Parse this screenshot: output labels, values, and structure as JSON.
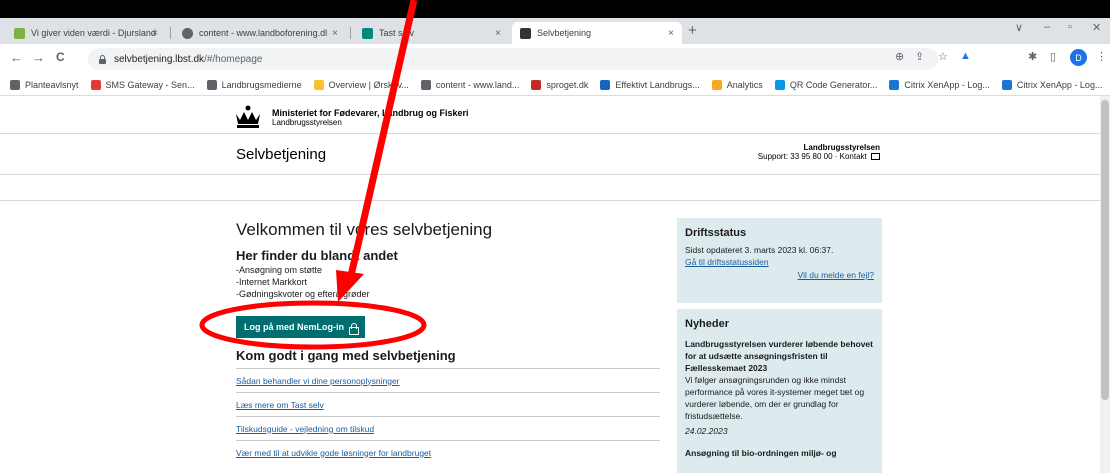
{
  "browser": {
    "tabs": [
      {
        "title": "Vi giver viden værdi - Djursland",
        "favicon_color": "#7cb342"
      },
      {
        "title": "content - www.landboforening.dl",
        "favicon_color": "#5f6368"
      },
      {
        "title": "Tast selv",
        "favicon_color": "#00897b"
      },
      {
        "title": "Selvbetjening",
        "favicon_color": "#333333"
      }
    ],
    "new_tab_label": "+",
    "tab_close": "×",
    "window_controls": {
      "chevron": "∨",
      "minimize": "–",
      "restore": "▫",
      "close": "✕"
    },
    "nav": {
      "back": "←",
      "forward": "→",
      "reload": "C"
    },
    "url_host": "selvbetjening.lbst.dk",
    "url_path": "/#/homepage",
    "profile_initial": "D",
    "toolbar_icons": {
      "zoom": "⊕",
      "share": "⇪",
      "star": "☆",
      "extensions": "✱",
      "sidebar": "▯",
      "menu": "⋮"
    },
    "bookmarks": [
      {
        "label": "Planteavlsnyt",
        "color": "#5f6368"
      },
      {
        "label": "SMS Gateway - Sen...",
        "color": "#e53935"
      },
      {
        "label": "Landbrugsmedierne",
        "color": "#5f6368"
      },
      {
        "label": "Overview | Ørskov...",
        "color": "#fbc02d"
      },
      {
        "label": "content - www.land...",
        "color": "#5f6368"
      },
      {
        "label": "sproget.dk",
        "color": "#c62828"
      },
      {
        "label": "Effektivt Landbrugs...",
        "color": "#1565c0"
      },
      {
        "label": "Analytics",
        "color": "#f9a825"
      },
      {
        "label": "QR Code Generator...",
        "color": "#039be5"
      },
      {
        "label": "Citrix XenApp - Log...",
        "color": "#1976d2"
      },
      {
        "label": "Citrix XenApp - Log...",
        "color": "#1976d2"
      }
    ]
  },
  "header": {
    "ministry_name": "Ministeriet for Fødevarer, Landbrug og Fiskeri",
    "ministry_sub": "Landbrugsstyrelsen",
    "site_title": "Selvbetjening",
    "support_org": "Landbrugsstyrelsen",
    "support_text": "Support: 33 95 80 00 · Kontakt"
  },
  "main": {
    "welcome": "Velkommen til vores selvbetjening",
    "subheading": "Her finder du blandt andet",
    "bullets": [
      "-Ansøgning om støtte",
      "-Internet Markkort",
      "-Gødningskvoter og efterafgrøder"
    ],
    "login_button": "Log på med NemLog-in",
    "guide_heading": "Kom godt i gang med selvbetjening",
    "links": [
      "Sådan behandler vi dine personoplysninger",
      "Læs mere om Tast selv",
      "Tilskudsguide - vejledning om tilskud",
      "Vær med til at udvikle gode løsninger for landbruget"
    ]
  },
  "sidebar": {
    "status_title": "Driftsstatus",
    "status_updated": "Sidst opdateret 3. marts 2023 kl. 06:37.",
    "status_link": "Gå til driftsstatussiden",
    "report_link": "Vil du melde en fejl?",
    "news_title": "Nyheder",
    "news": [
      {
        "headline": "Landbrugsstyrelsen vurderer løbende behovet for at udsætte ansøgningsfristen til Fællesskemaet 2023",
        "body": "Vi følger ansøgningsrunden og ikke mindst performance på vores it-systemer meget tæt og vurderer løbende, om der er grundlag for fristudsættelse.",
        "date": "24.02.2023"
      },
      {
        "headline": "Ansøgning til bio-ordningen miljø- og"
      }
    ]
  },
  "annotation_color": "#ff0000"
}
